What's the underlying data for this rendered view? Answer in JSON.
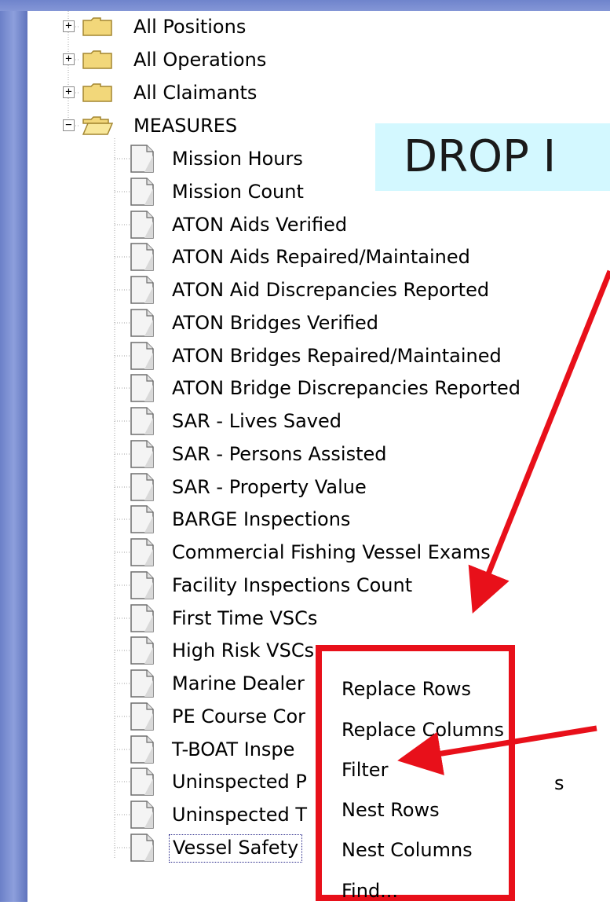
{
  "tree": {
    "folders": [
      {
        "label": "All Positions",
        "expander": "+"
      },
      {
        "label": "All Operations",
        "expander": "+"
      },
      {
        "label": "All Claimants",
        "expander": "+"
      },
      {
        "label": "MEASURES",
        "expander": "−"
      }
    ],
    "measures": [
      "Mission Hours",
      "Mission Count",
      "ATON Aids Verified",
      "ATON Aids Repaired/Maintained",
      "ATON Aid Discrepancies Reported",
      "ATON Bridges Verified",
      "ATON Bridges Repaired/Maintained",
      "ATON Bridge Discrepancies Reported",
      "SAR - Lives Saved",
      "SAR - Persons Assisted",
      "SAR - Property Value",
      "BARGE Inspections",
      "Commercial Fishing Vessel Exams",
      "Facility Inspections Count",
      "First Time VSCs",
      "High Risk VSCs",
      "Marine Dealer",
      "PE Course Cor",
      "T-BOAT Inspe",
      "Uninspected P",
      "Uninspected T",
      "Vessel Safety"
    ],
    "hidden_suffix_row19": "s"
  },
  "drop_label": "DROP I",
  "context_menu": {
    "items": [
      "Replace Rows",
      "Replace Columns",
      "Filter",
      "Nest Rows",
      "Nest Columns",
      "Find..."
    ]
  },
  "colors": {
    "highlight_box": "#e8101a",
    "drop_label_bg": "#d3f8ff",
    "slide_blue": "#7b8fd4"
  }
}
